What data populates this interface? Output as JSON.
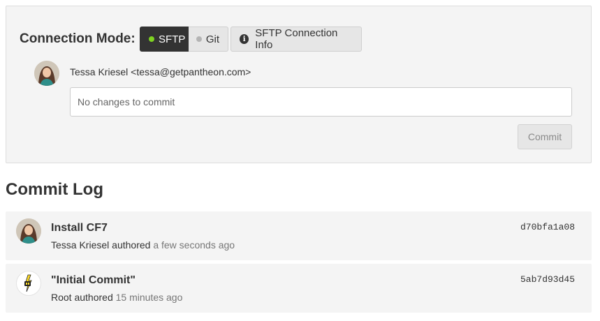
{
  "connection": {
    "label": "Connection Mode:",
    "modes": [
      {
        "label": "SFTP",
        "active": true,
        "status_color": "#7ed321"
      },
      {
        "label": "Git",
        "active": false,
        "status_color": "#b4b4b4"
      }
    ],
    "info_button": {
      "label": "SFTP Connection Info",
      "icon": "info-circle-icon"
    }
  },
  "composer": {
    "author": "Tessa Kriesel <tessa@getpantheon.com>",
    "input_placeholder": "No changes to commit",
    "commit_label": "Commit"
  },
  "commit_log": {
    "title": "Commit Log",
    "commits": [
      {
        "message": "Install CF7",
        "author": "Tessa Kriesel",
        "verb": "authored",
        "when": "a few seconds ago",
        "hash": "d70bfa1a08",
        "avatar": "user-avatar"
      },
      {
        "message": "\"Initial Commit\"",
        "author": "Root",
        "verb": "authored",
        "when": "15 minutes ago",
        "hash": "5ab7d93d45",
        "avatar": "pantheon-logo"
      }
    ]
  },
  "colors": {
    "accent_dark": "#333333",
    "panel_bg": "#f4f4f4",
    "status_green": "#7ed321"
  }
}
